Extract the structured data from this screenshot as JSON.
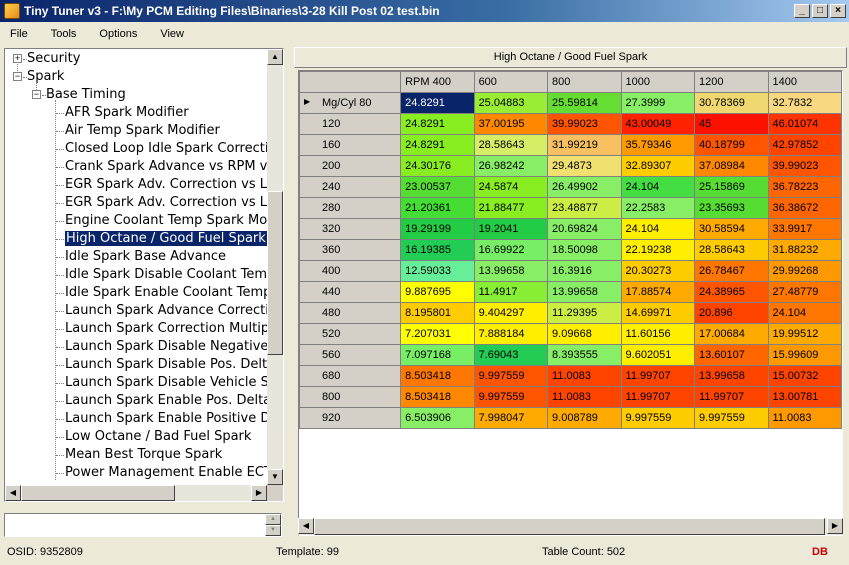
{
  "window": {
    "title": "Tiny Tuner v3 - F:\\My PCM Editing Files\\Binaries\\3-28 Kill Post 02 test.bin"
  },
  "menu": [
    "File",
    "Tools",
    "Options",
    "View"
  ],
  "tree": {
    "security": "Security",
    "spark": "Spark",
    "base_timing": "Base Timing",
    "items": [
      "AFR Spark Modifier",
      "Air Temp Spark Modifier",
      "Closed Loop Idle Spark Correction",
      "Crank Spark Advance vs RPM vs",
      "EGR Spark Adv. Correction vs Loa",
      "EGR Spark Adv. Correction vs Loa",
      "Engine Coolant Temp Spark Modif",
      "High Octane / Good Fuel Spark",
      "Idle Spark Base Advance",
      "Idle Spark Disable Coolant Temp.",
      "Idle Spark Enable Coolant Temp.",
      "Launch Spark Advance Correction",
      "Launch Spark Correction Multiplier",
      "Launch Spark Disable Negative D",
      "Launch Spark Disable Pos. Delta",
      "Launch Spark Disable Vehicle Sp",
      "Launch Spark Enable Pos. Delta M",
      "Launch Spark Enable Positive De",
      "Low Octane / Bad Fuel Spark",
      "Mean Best Torque Spark",
      "Power Management Enable ECT"
    ],
    "selected_index": 7
  },
  "table": {
    "title": "High Octane / Good Fuel Spark",
    "columns": [
      "RPM 400",
      "600",
      "800",
      "1000",
      "1200",
      "1400"
    ],
    "row_header_first": "Mg/Cyl 80",
    "rows": [
      {
        "label": "Mg/Cyl 80",
        "values": [
          "24.8291",
          "25.04883",
          "25.59814",
          "27.3999",
          "30.78369",
          "32.7832"
        ]
      },
      {
        "label": "120",
        "values": [
          "24.8291",
          "37.00195",
          "39.99023",
          "43.00049",
          "45",
          "46.01074"
        ]
      },
      {
        "label": "160",
        "values": [
          "24.8291",
          "28.58643",
          "31.99219",
          "35.79346",
          "40.18799",
          "42.97852"
        ]
      },
      {
        "label": "200",
        "values": [
          "24.30176",
          "26.98242",
          "29.4873",
          "32.89307",
          "37.08984",
          "39.99023"
        ]
      },
      {
        "label": "240",
        "values": [
          "23.00537",
          "24.5874",
          "26.49902",
          "24.104",
          "25.15869",
          "36.78223"
        ]
      },
      {
        "label": "280",
        "values": [
          "21.20361",
          "21.88477",
          "23.48877",
          "22.2583",
          "23.35693",
          "36.38672"
        ]
      },
      {
        "label": "320",
        "values": [
          "19.29199",
          "19.2041",
          "20.69824",
          "24.104",
          "30.58594",
          "33.9917"
        ]
      },
      {
        "label": "360",
        "values": [
          "16.19385",
          "16.69922",
          "18.50098",
          "22.19238",
          "28.58643",
          "31.88232"
        ]
      },
      {
        "label": "400",
        "values": [
          "12.59033",
          "13.99658",
          "16.3916",
          "20.30273",
          "26.78467",
          "29.99268"
        ]
      },
      {
        "label": "440",
        "values": [
          "9.887695",
          "11.4917",
          "13.99658",
          "17.88574",
          "24.38965",
          "27.48779"
        ]
      },
      {
        "label": "480",
        "values": [
          "8.195801",
          "9.404297",
          "11.29395",
          "14.69971",
          "20.896",
          "24.104"
        ]
      },
      {
        "label": "520",
        "values": [
          "7.207031",
          "7.888184",
          "9.09668",
          "11.60156",
          "17.00684",
          "19.99512"
        ]
      },
      {
        "label": "560",
        "values": [
          "7.097168",
          "7.69043",
          "8.393555",
          "9.602051",
          "13.60107",
          "15.99609"
        ]
      },
      {
        "label": "680",
        "values": [
          "8.503418",
          "9.997559",
          "11.0083",
          "11.99707",
          "13.99658",
          "15.00732"
        ]
      },
      {
        "label": "800",
        "values": [
          "8.503418",
          "9.997559",
          "11.0083",
          "11.99707",
          "11.99707",
          "13.00781"
        ]
      },
      {
        "label": "920",
        "values": [
          "6.503906",
          "7.998047",
          "9.008789",
          "9.997559",
          "9.997559",
          "11.0083"
        ]
      }
    ],
    "colors": [
      [
        "#0a246a",
        "#99ee33",
        "#66dd33",
        "#88ee66",
        "#f0d870",
        "#f8d880"
      ],
      [
        "#88ee22",
        "#ff8800",
        "#ff5500",
        "#ff2200",
        "#ff1100",
        "#ff3300"
      ],
      [
        "#88ee22",
        "#d4ee66",
        "#f8c060",
        "#ff9900",
        "#ff5500",
        "#ff4400"
      ],
      [
        "#88ee22",
        "#88ee66",
        "#f0e070",
        "#ffcc00",
        "#ff8800",
        "#ff5500"
      ],
      [
        "#55dd33",
        "#88ee22",
        "#88ee66",
        "#44dd44",
        "#55dd33",
        "#ff6600"
      ],
      [
        "#44dd33",
        "#88ee22",
        "#ccee44",
        "#88ee66",
        "#55dd33",
        "#ff6600"
      ],
      [
        "#22cc44",
        "#22cc44",
        "#88ee66",
        "#ffee00",
        "#ffaa00",
        "#ff7700"
      ],
      [
        "#22cc55",
        "#77ee66",
        "#88ee66",
        "#ffee00",
        "#ffcc00",
        "#ffaa00"
      ],
      [
        "#66ee99",
        "#88ee66",
        "#88ee66",
        "#ffcc00",
        "#ff7700",
        "#ff9900"
      ],
      [
        "#ffff00",
        "#88ee33",
        "#88ee66",
        "#ffaa00",
        "#ff5500",
        "#ff7700"
      ],
      [
        "#ffcc00",
        "#ffee00",
        "#ccee44",
        "#ffcc00",
        "#ff4400",
        "#ff7700"
      ],
      [
        "#ffff00",
        "#ffee00",
        "#ffee00",
        "#ffee00",
        "#ffaa00",
        "#ffaa00"
      ],
      [
        "#77ee66",
        "#22cc55",
        "#88ee66",
        "#ffee00",
        "#ff6600",
        "#ff9900"
      ],
      [
        "#ff7700",
        "#ff5500",
        "#ff4400",
        "#ff4400",
        "#ff4400",
        "#ff4400"
      ],
      [
        "#ff8800",
        "#ff5500",
        "#ff4400",
        "#ff4400",
        "#ff4400",
        "#ff4400"
      ],
      [
        "#88ee66",
        "#ffaa00",
        "#ffaa00",
        "#ffcc00",
        "#ffcc00",
        "#ff9900"
      ]
    ]
  },
  "status": {
    "osid": "OSID: 9352809",
    "template": "Template: 99",
    "table_count": "Table Count: 502",
    "db": "DB"
  }
}
